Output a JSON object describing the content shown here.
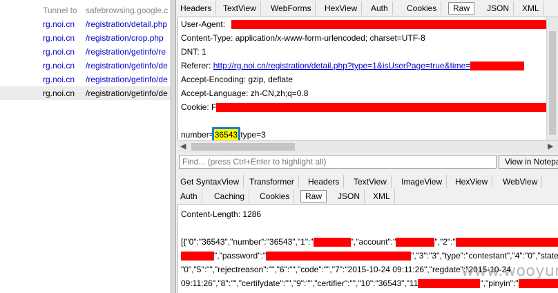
{
  "sessions": [
    {
      "host": "Tunnel to",
      "url": "safebrowsing.google.c",
      "kind": "tunnel"
    },
    {
      "host": "rg.noi.cn",
      "url": "/registration/detail.php",
      "kind": "link"
    },
    {
      "host": "rg.noi.cn",
      "url": "/registration/crop.php",
      "kind": "link"
    },
    {
      "host": "rg.noi.cn",
      "url": "/registration/getinfo/re",
      "kind": "link"
    },
    {
      "host": "rg.noi.cn",
      "url": "/registration/getinfo/de",
      "kind": "link"
    },
    {
      "host": "rg.noi.cn",
      "url": "/registration/getinfo/de",
      "kind": "link"
    },
    {
      "host": "rg.noi.cn",
      "url": "/registration/getinfo/de",
      "kind": "selected"
    }
  ],
  "request": {
    "tabs": [
      "Headers",
      "TextView",
      "WebForms",
      "HexView",
      "Auth",
      "Cookies",
      "Raw",
      "JSON",
      "XML"
    ],
    "active_tab": "Raw",
    "lines": {
      "user_agent": "User-Agent:",
      "content_type": "Content-Type: application/x-www-form-urlencoded; charset=UTF-8",
      "dnt": "DNT: 1",
      "referer_label": "Referer:",
      "referer_url": "http://rg.noi.cn/registration/detail.php?type=1&isUserPage=true&time=",
      "accept_encoding": "Accept-Encoding: gzip, deflate",
      "accept_language": "Accept-Language: zh-CN,zh;q=0.8",
      "cookie": "Cookie: F",
      "body_prefix": "number=",
      "body_number": "36543",
      "body_suffix": "type=3"
    }
  },
  "find": {
    "placeholder": "Find... (press Ctrl+Enter to highlight all)",
    "button": "View in Notepa"
  },
  "response": {
    "tabs_row1": [
      "Get SyntaxView",
      "Transformer",
      "Headers",
      "TextView",
      "ImageView",
      "HexView",
      "WebView"
    ],
    "tabs_row2": [
      "Auth",
      "Caching",
      "Cookies",
      "Raw",
      "JSON",
      "XML"
    ],
    "active_tab": "Raw",
    "content_length": "Content-Length: 1286",
    "json_line1_a": "[{\"0\":\"36543\",\"number\":\"36543\",\"1\":\"",
    "json_line1_b": "\",\"account\":\"",
    "json_line1_c": "\",\"2\":\"",
    "json_line2_a": "\",\"password\":\"",
    "json_line2_b": "\",\"3\":\"3\",\"type\":\"contestant\",\"4\":\"0\",\"state\":",
    "json_line3": "\"0\",\"5\":\"\",\"rejectreason\":\"\",\"6\":\"\",\"code\":\"\",\"7\":\"2015-10-24 09:11:26\",\"regdate\":\"2015-10-24",
    "json_line4_a": "09:11:26\",\"8\":\"\",\"certifydate\":\"\",\"9\":\"\",\"certifier\":\"\",\"10\":\"36543\",\"11",
    "json_line4_b": "\",\"pinyin\":\""
  },
  "watermark": "www.wooyun.org",
  "colors": {
    "redaction": "#ff0000",
    "highlight": "#ffff00",
    "highlight_border": "#1c7fd6",
    "link": "#0000cc"
  }
}
